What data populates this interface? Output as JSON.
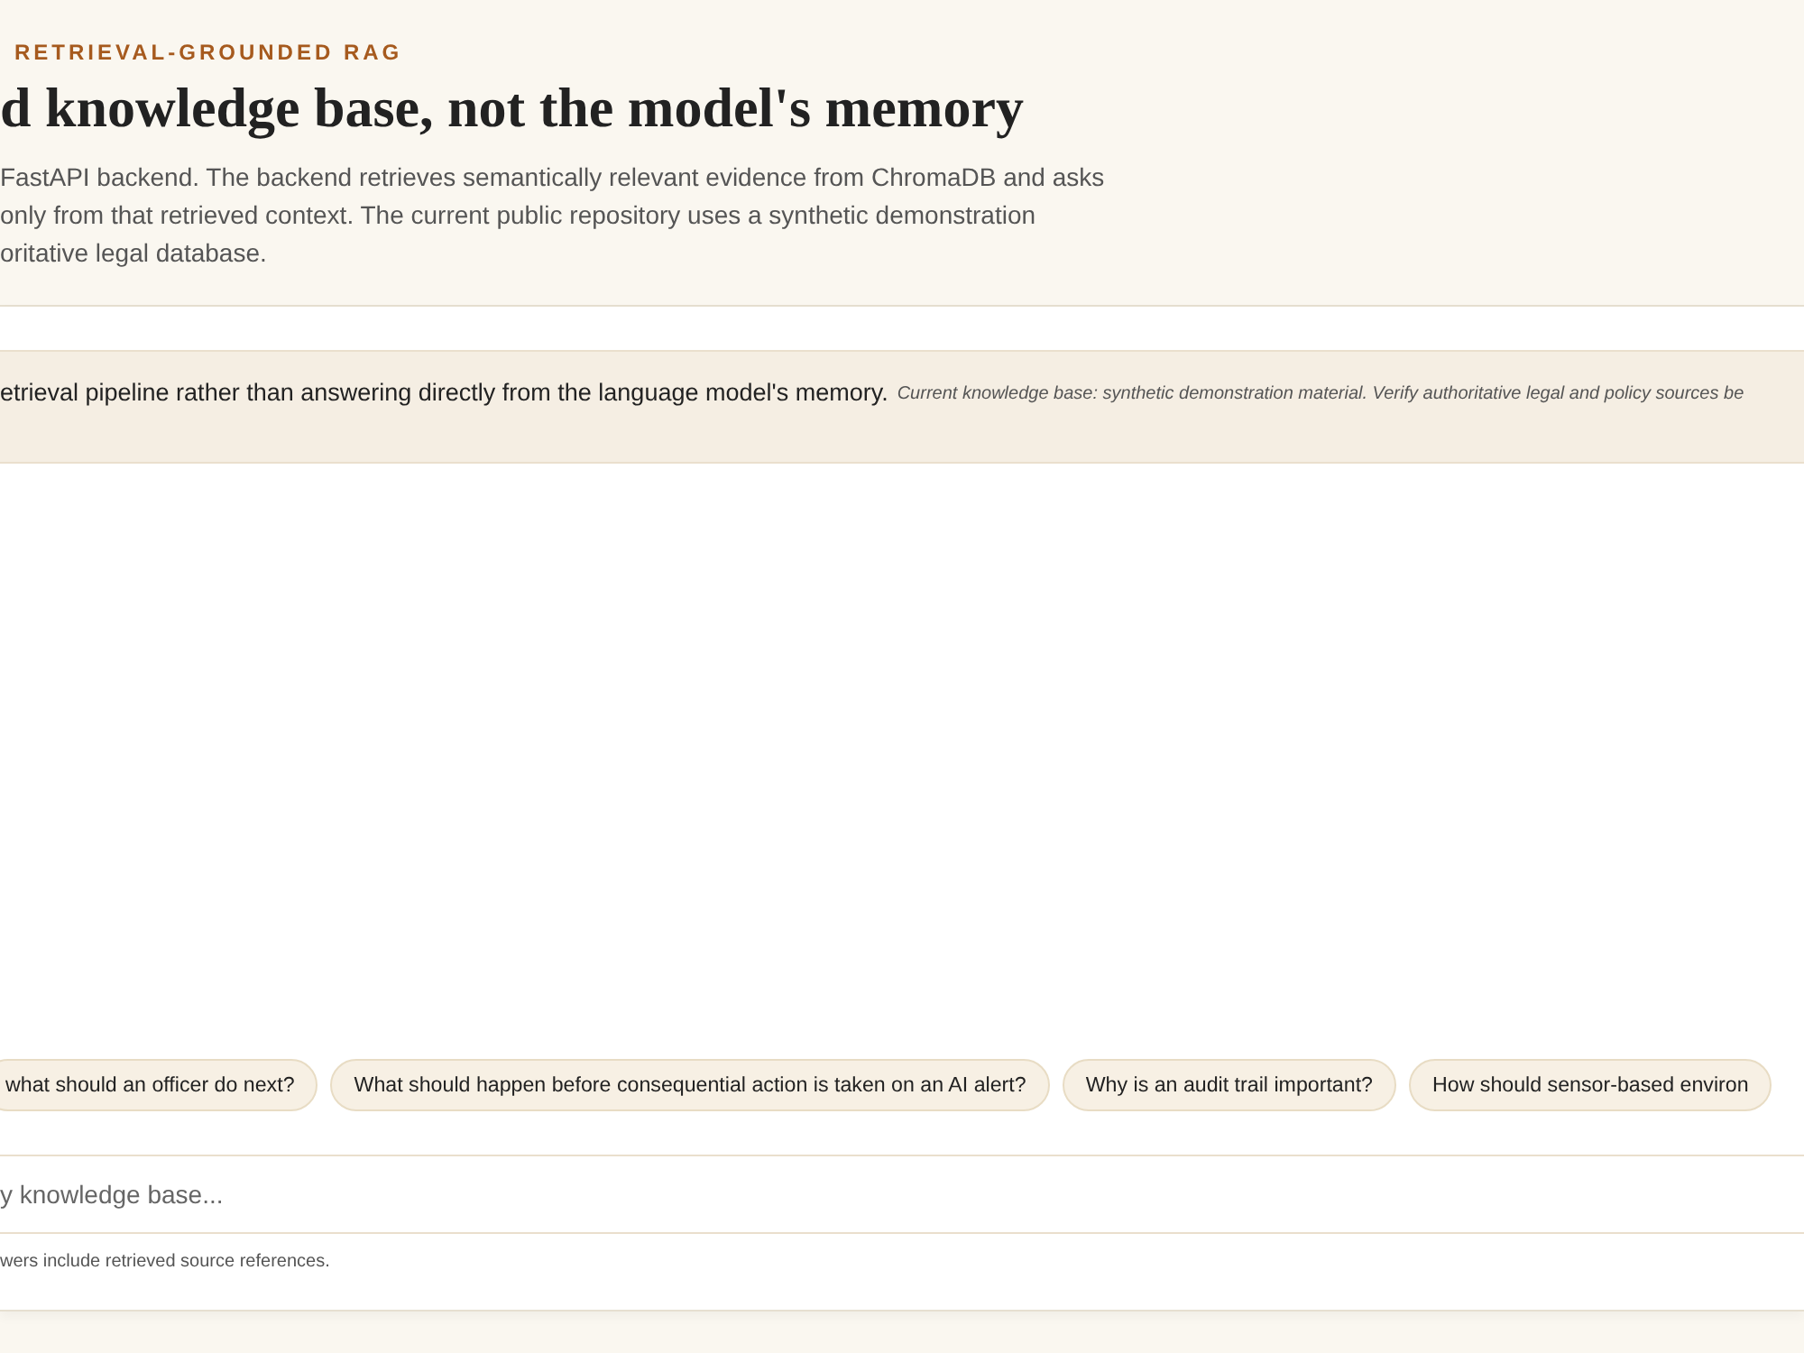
{
  "header": {
    "eyebrow": "RETRIEVAL-GROUNDED RAG",
    "title": "d knowledge base, not the model's memory",
    "description": "FastAPI backend. The backend retrieves semantically relevant evidence from ChromaDB and asks\nonly from that retrieved context. The current public repository uses a synthetic demonstration\noritative legal database."
  },
  "notice": {
    "text": "etrieval pipeline rather than answering directly from the language model's memory.",
    "note": "Current knowledge base: synthetic demonstration material. Verify authoritative legal and policy sources be"
  },
  "suggestions": [
    "what should an officer do next?",
    "What should happen before consequential action is taken on an AI alert?",
    "Why is an audit trail important?",
    "How should sensor-based environ"
  ],
  "composer": {
    "placeholder": "y knowledge base...",
    "footnote": "wers include retrieved source references."
  }
}
